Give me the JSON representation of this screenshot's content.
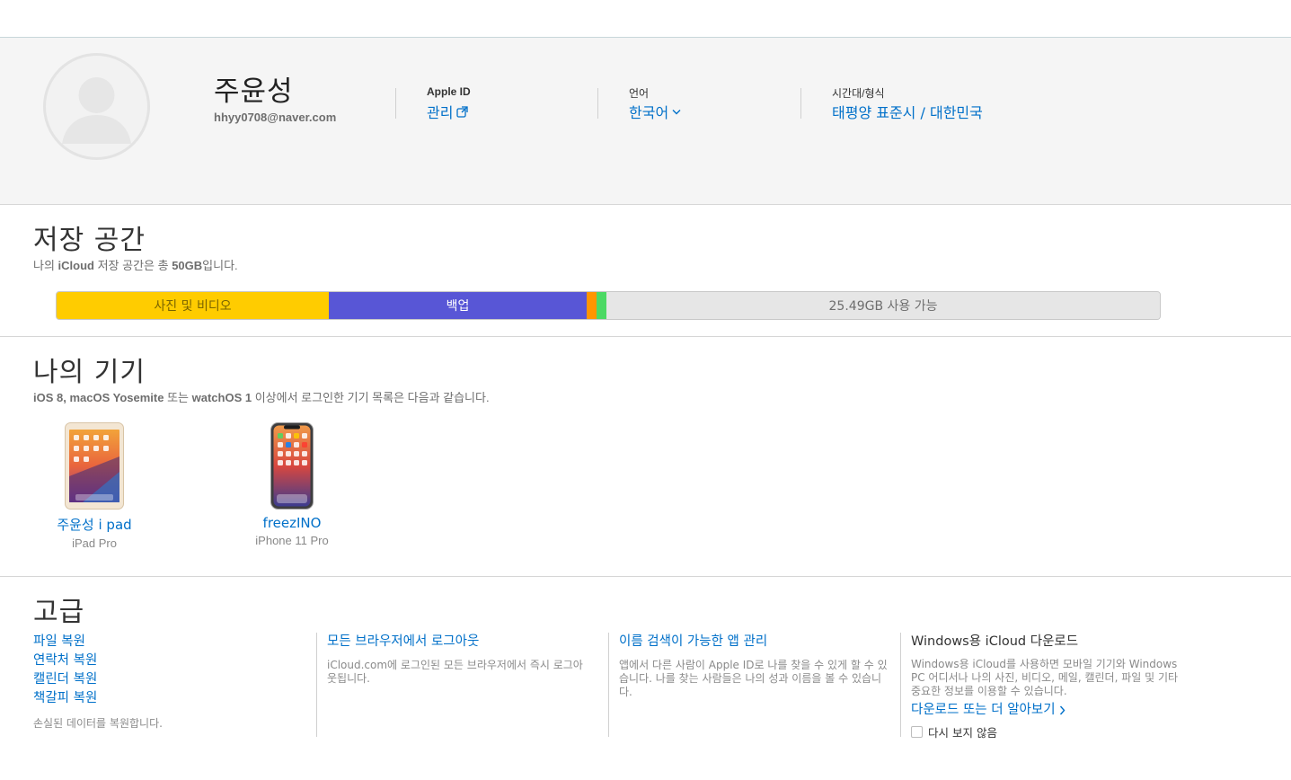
{
  "profile": {
    "name": "주윤성",
    "email": "hhyy0708@naver.com",
    "apple_id_label": "Apple ID",
    "apple_id_link": "관리",
    "language_label": "언어",
    "language_value": "한국어",
    "timezone_label": "시간대/형식",
    "timezone_value": "태평양 표준시 / 대한민국"
  },
  "storage": {
    "title": "저장 공간",
    "subtitle_pre": "나의 ",
    "subtitle_brand": "iCloud",
    "subtitle_mid": " 저장 공간은 총 ",
    "subtitle_total": "50GB",
    "subtitle_post": "입니다.",
    "total_gb": 50,
    "segments": [
      {
        "key": "photos",
        "label": "사진 및 비디오",
        "fraction": 0.247,
        "color": "#ffcc00"
      },
      {
        "key": "backup",
        "label": "백업",
        "fraction": 0.234,
        "color": "#5856d6"
      },
      {
        "key": "other1",
        "label": "",
        "fraction": 0.009,
        "color": "#ff9500"
      },
      {
        "key": "other2",
        "label": "",
        "fraction": 0.009,
        "color": "#4cd964"
      }
    ],
    "free_label": "25.49GB 사용 가능"
  },
  "devices": {
    "title": "나의 기기",
    "subtitle_b1": "iOS 8, macOS Yosemite",
    "subtitle_t1": " 또는 ",
    "subtitle_b2": "watchOS 1",
    "subtitle_t2": " 이상에서 로그인한 기기 목록은 다음과 같습니다.",
    "items": [
      {
        "name": "주윤성 i pad",
        "model": "iPad Pro",
        "icon": "ipad-icon"
      },
      {
        "name": "freezINO",
        "model": "iPhone 11 Pro",
        "icon": "iphone-icon"
      }
    ]
  },
  "advanced": {
    "title": "고급",
    "restore_links": [
      "파일 복원",
      "연락처 복원",
      "캘린더 복원",
      "책갈피 복원"
    ],
    "restore_desc": "손실된 데이터를 복원합니다.",
    "signout_link": "모든 브라우저에서 로그아웃",
    "signout_desc": "iCloud.com에 로그인된 모든 브라우저에서 즉시 로그아웃됩니다.",
    "findme_link": "이름 검색이 가능한 앱 관리",
    "findme_desc": "앱에서 다른 사람이 Apple ID로 나를 찾을 수 있게 할 수 있습니다. 나를 찾는 사람들은 나의 성과 이름을 볼 수 있습니다.",
    "windows_title": "Windows용 iCloud 다운로드",
    "windows_desc": "Windows용 iCloud를 사용하면 모바일 기기와 Windows PC 어디서나 나의 사진, 비디오, 메일, 캘린더, 파일 및 기타 중요한 정보를 이용할 수 있습니다.",
    "windows_link": "다운로드 또는 더 알아보기",
    "dont_show": "다시 보지 않음"
  },
  "colors": {
    "link": "#0070c9",
    "photos": "#ffcc00",
    "backup": "#5856d6"
  }
}
